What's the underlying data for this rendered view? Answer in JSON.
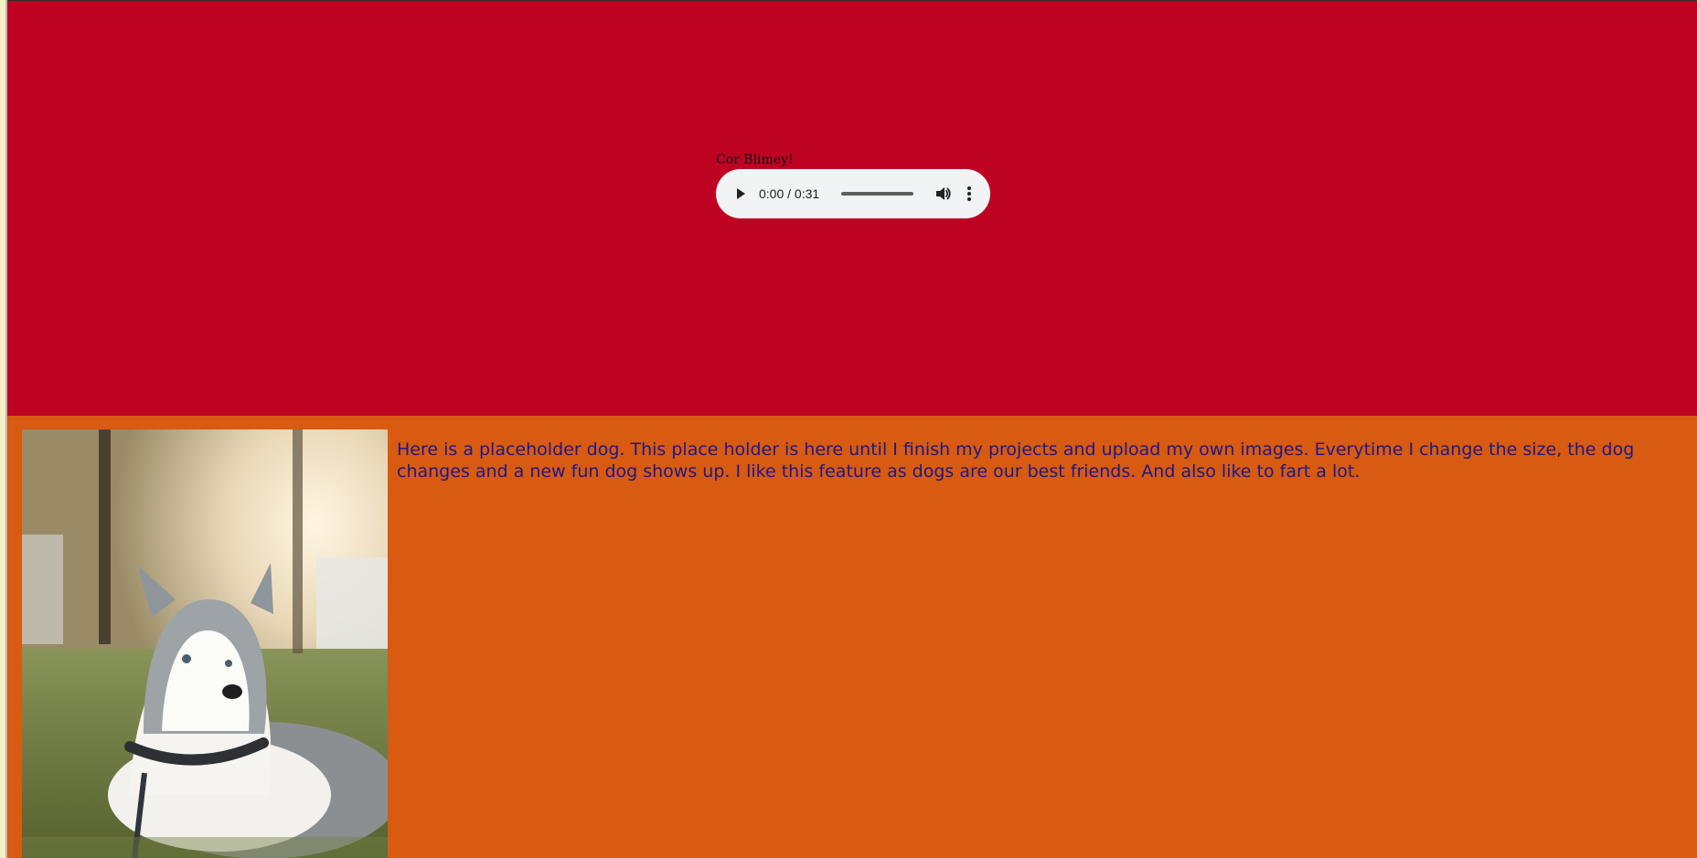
{
  "audio": {
    "caption": "Cor Blimey!",
    "time_display": "0:00 / 0:31",
    "progress": 0,
    "controls": {
      "play": "play-icon",
      "volume": "volume-icon",
      "more": "more-vertical-icon"
    }
  },
  "content": {
    "image_subject": "husky dog lying on grass",
    "paragraph": "Here is a placeholder dog. This place holder is here until I finish my projects and upload my own images. Everytime I change the size, the dog changes and a new fun dog shows up. I like this feature as dogs are our best friends. And also like to fart a lot."
  },
  "colors": {
    "header_background": "#bf0423",
    "content_background": "#d95a11",
    "paragraph_text": "#1b1a86",
    "player_background": "#f1f3f4"
  }
}
